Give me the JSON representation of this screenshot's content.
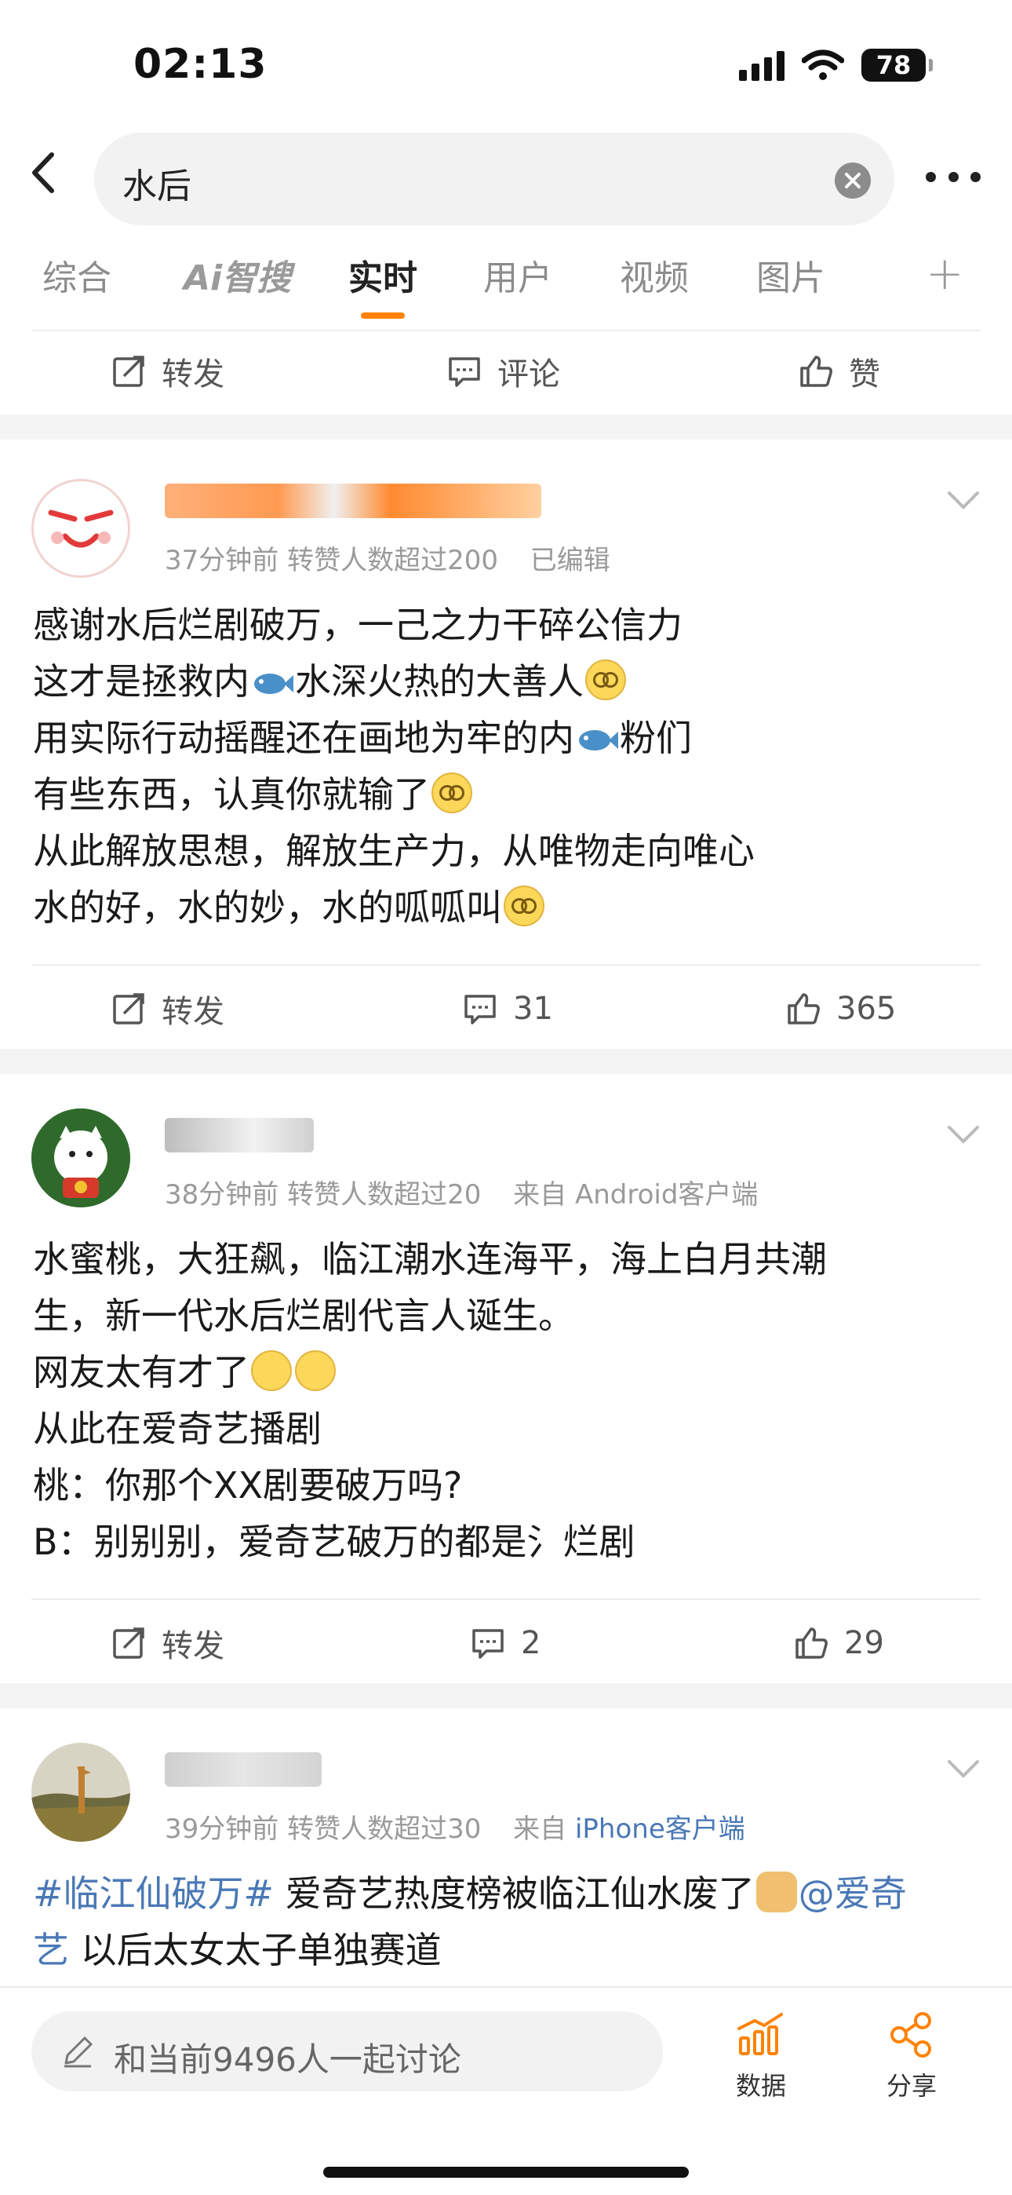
{
  "status_bar": {
    "time": "02:13",
    "battery": "78"
  },
  "search": {
    "query": "水后"
  },
  "tabs": [
    {
      "label": "综合",
      "active": false
    },
    {
      "label": "Ai智搜",
      "active": false
    },
    {
      "label": "实时",
      "active": true
    },
    {
      "label": "用户",
      "active": false
    },
    {
      "label": "视频",
      "active": false
    },
    {
      "label": "图片",
      "active": false
    }
  ],
  "tab_plus": "+",
  "top_actions": {
    "repost": "转发",
    "comment": "评论",
    "like": "赞"
  },
  "posts": [
    {
      "meta": "37分钟前  转赞人数超过200",
      "meta_extra": "已编辑",
      "lines": [
        "感谢水后烂剧破万，一己之力干碎公信力",
        "这才是拯救内",
        "水深火热的大善人",
        "用实际行动摇醒还在画地为牢的内",
        "粉们",
        "有些东西，认真你就输了",
        "从此解放思想，解放生产力，从唯物走向唯心",
        "水的好，水的妙，水的呱呱叫"
      ],
      "repost": "转发",
      "comments": "31",
      "likes": "365"
    },
    {
      "meta": "38分钟前  转赞人数超过20",
      "meta_extra": "来自 Android客户端",
      "lines": [
        "水蜜桃，大狂飙，临江潮水连海平，海上白月共潮",
        "生，新一代水后烂剧代言人诞生。",
        "网友太有才了",
        "从此在爱奇艺播剧",
        "桃：你那个XX剧要破万吗?",
        "B：别别别，爱奇艺破万的都是氵烂剧"
      ],
      "repost": "转发",
      "comments": "2",
      "likes": "29"
    },
    {
      "meta": "39分钟前  转赞人数超过30",
      "meta_from": "来自",
      "meta_client": "iPhone客户端",
      "hashtag": "#临江仙破万#",
      "line1_text": " 爱奇艺热度榜被临江仙水废了",
      "mention_a": "@爱奇",
      "mention_b": "艺",
      "line2_text": " 以后太女太子单独赛道"
    }
  ],
  "bottom_bar": {
    "placeholder": "和当前9496人一起讨论",
    "data_label": "数据",
    "share_label": "分享"
  },
  "colors": {
    "accent": "#ff8200",
    "link": "#4a78b6",
    "username": "#ff6a00"
  }
}
